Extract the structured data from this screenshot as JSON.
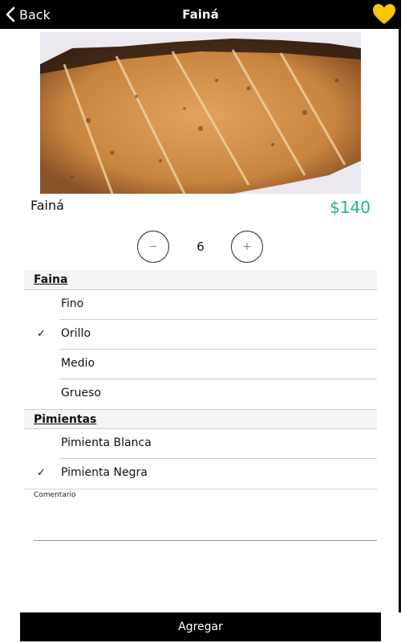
{
  "nav": {
    "back_label": "Back",
    "title": "Fainá",
    "favorite_icon": "heart-icon",
    "favorite_color": "#f5c800"
  },
  "product": {
    "name": "Fainá",
    "price": "$140",
    "price_color": "#1db584"
  },
  "quantity": {
    "decrement_label": "−",
    "value": "6",
    "increment_label": "+"
  },
  "groups": [
    {
      "title": "Faina",
      "options": [
        {
          "label": "Fino",
          "selected": false
        },
        {
          "label": "Orillo",
          "selected": true
        },
        {
          "label": "Medio",
          "selected": false
        },
        {
          "label": "Grueso",
          "selected": false
        }
      ]
    },
    {
      "title": "Pimientas",
      "options": [
        {
          "label": "Pimienta Blanca",
          "selected": false
        },
        {
          "label": "Pimienta Negra",
          "selected": true
        }
      ]
    }
  ],
  "comment": {
    "label": "Comentario",
    "value": ""
  },
  "submit_label": "Agregar",
  "check_mark": "✓"
}
